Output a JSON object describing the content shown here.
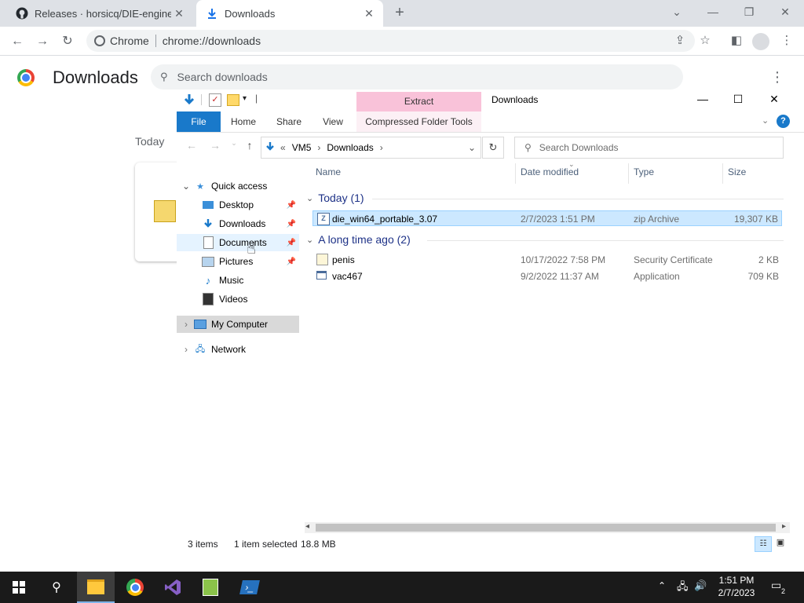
{
  "browser": {
    "tabs": [
      {
        "title": "Releases · horsicq/DIE-engine",
        "active": false
      },
      {
        "title": "Downloads",
        "active": true
      }
    ],
    "omnibox": {
      "site": "Chrome",
      "url": "chrome://downloads"
    }
  },
  "downloads_page": {
    "title": "Downloads",
    "search_placeholder": "Search downloads",
    "section": "Today"
  },
  "explorer": {
    "quick_access_toolbar": "|",
    "context_tab": "Extract",
    "window_title": "Downloads",
    "ribbon_tabs": [
      "File",
      "Home",
      "Share",
      "View",
      "Compressed Folder Tools"
    ],
    "address": {
      "prefix": "«",
      "parts": [
        "VM5",
        "Downloads"
      ]
    },
    "search_placeholder": "Search Downloads",
    "nav": {
      "quick_access": "Quick access",
      "items": [
        "Desktop",
        "Downloads",
        "Documents",
        "Pictures",
        "Music",
        "Videos"
      ],
      "my_computer": "My Computer",
      "network": "Network"
    },
    "columns": [
      "Name",
      "Date modified",
      "Type",
      "Size"
    ],
    "groups": [
      {
        "label": "Today (1)",
        "files": [
          {
            "name": "die_win64_portable_3.07",
            "date": "2/7/2023 1:51 PM",
            "type": "zip Archive",
            "size": "19,307 KB",
            "selected": true
          }
        ]
      },
      {
        "label": "A long time ago (2)",
        "files": [
          {
            "name": "penis",
            "date": "10/17/2022 7:58 PM",
            "type": "Security Certificate",
            "size": "2 KB",
            "selected": false
          },
          {
            "name": "vac467",
            "date": "9/2/2022 11:37 AM",
            "type": "Application",
            "size": "709 KB",
            "selected": false
          }
        ]
      }
    ],
    "status": {
      "items": "3 items",
      "selected": "1 item selected",
      "size": "18.8 MB"
    }
  },
  "taskbar": {
    "clock_time": "1:51 PM",
    "clock_date": "2/7/2023",
    "notification_count": "2"
  }
}
